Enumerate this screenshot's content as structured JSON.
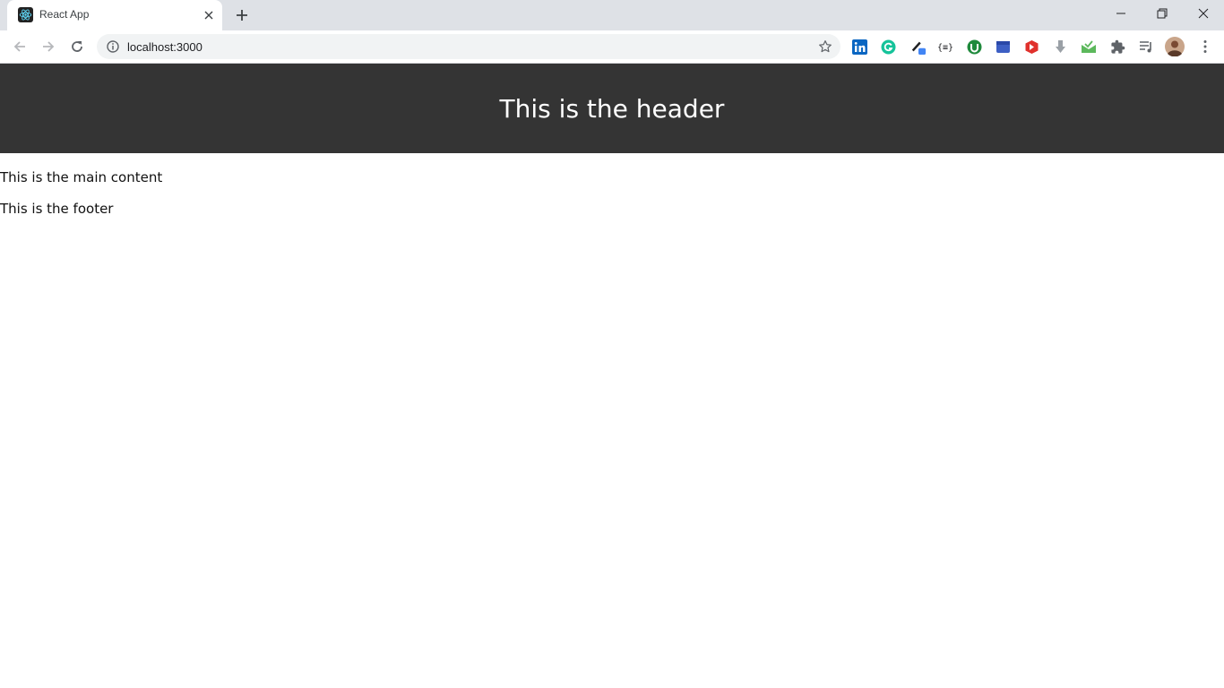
{
  "browser": {
    "tab": {
      "title": "React App",
      "favicon": "react-logo-icon"
    },
    "address_bar": {
      "url": "localhost:3000"
    },
    "extensions": [
      "linkedin-icon",
      "grammarly-icon",
      "pen-tool-icon",
      "json-formatter-icon",
      "green-extension-icon",
      "blue-extension-icon",
      "red-extension-icon",
      "download-icon",
      "mail-tracker-icon"
    ],
    "colors": {
      "tabstrip": "#dee1e6",
      "omnibox": "#f1f3f4"
    }
  },
  "page": {
    "header_title": "This is the header",
    "main_text": "This is the main content",
    "footer_text": "This is the footer",
    "colors": {
      "header_bg": "#343434",
      "header_text": "#ffffff"
    }
  }
}
